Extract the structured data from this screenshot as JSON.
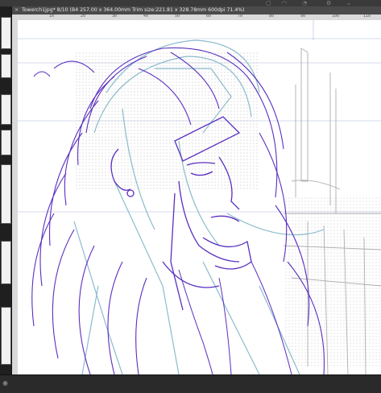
{
  "document_tab": {
    "close_glyph": "×",
    "title": "Towerch1jpg* 8/10 (B4 257.00 x 364.00mm Trim size:221.81 x 328.78mm 600dpi 71.4%)"
  },
  "ruler": {
    "labels": [
      "10",
      "20",
      "30",
      "40",
      "50",
      "60",
      "70",
      "80",
      "90",
      "100",
      "110",
      "120"
    ]
  },
  "icons": {
    "window_menu": "chevron-down-icon",
    "canvas_tab_close": "close-icon"
  },
  "colors": {
    "sketch_purple": "#5a2fbf",
    "sketch_teal": "#7fb4c8",
    "guide_blue": "#aab8d8",
    "panel_dark": "#1f1f1f",
    "tab_bar": "#4a4a4a"
  }
}
